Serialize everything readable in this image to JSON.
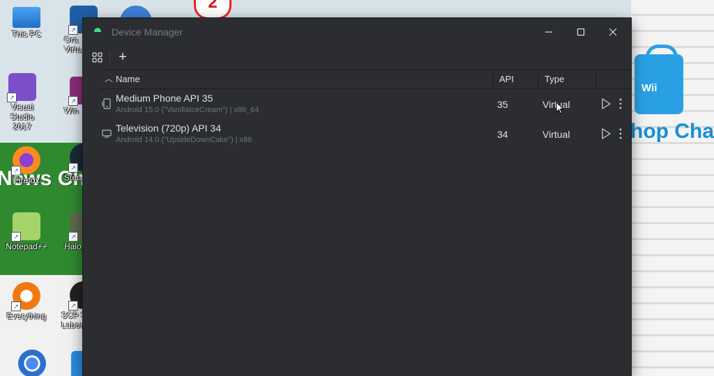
{
  "desktop": {
    "icons": [
      {
        "id": "this-pc",
        "label": "This PC"
      },
      {
        "id": "oracle",
        "label": "Ora\nVirtu"
      },
      {
        "id": "visual-studio",
        "label": "Visual Studio\n2017"
      },
      {
        "id": "winrar",
        "label": "Win"
      },
      {
        "id": "firefox",
        "label": "Firefox"
      },
      {
        "id": "steam",
        "label": "Stea"
      },
      {
        "id": "notepadpp",
        "label": "Notepad++"
      },
      {
        "id": "halo",
        "label": "Halo"
      },
      {
        "id": "everything",
        "label": "Everything"
      },
      {
        "id": "scp",
        "label": "SCP S\nLabor"
      }
    ],
    "wallpaper_left_text": "News Ch",
    "wallpaper_right_text": "hop Channe",
    "bag_text": "Wii",
    "badge_number": "2"
  },
  "window": {
    "title": "Device Manager",
    "controls": {
      "minimize": "—",
      "maximize": "☐",
      "close": "✕"
    },
    "toolbar": {
      "add_label": "+"
    },
    "columns": {
      "name": "Name",
      "api": "API",
      "type": "Type"
    },
    "devices": [
      {
        "name": "Medium Phone API 35",
        "details": "Android 15.0 (\"VanillaIceCream\") | x86_64",
        "api": "35",
        "type": "Virtual",
        "icon": "phone-icon"
      },
      {
        "name": "Television (720p) API 34",
        "details": "Android 14.0 (\"UpsideDownCake\") | x86",
        "api": "34",
        "type": "Virtual",
        "icon": "tv-icon"
      }
    ]
  },
  "colors": {
    "window_bg": "#2b2d30",
    "text": "#dfe1e5",
    "muted": "#6f737a",
    "android_green": "#3ddc84"
  }
}
